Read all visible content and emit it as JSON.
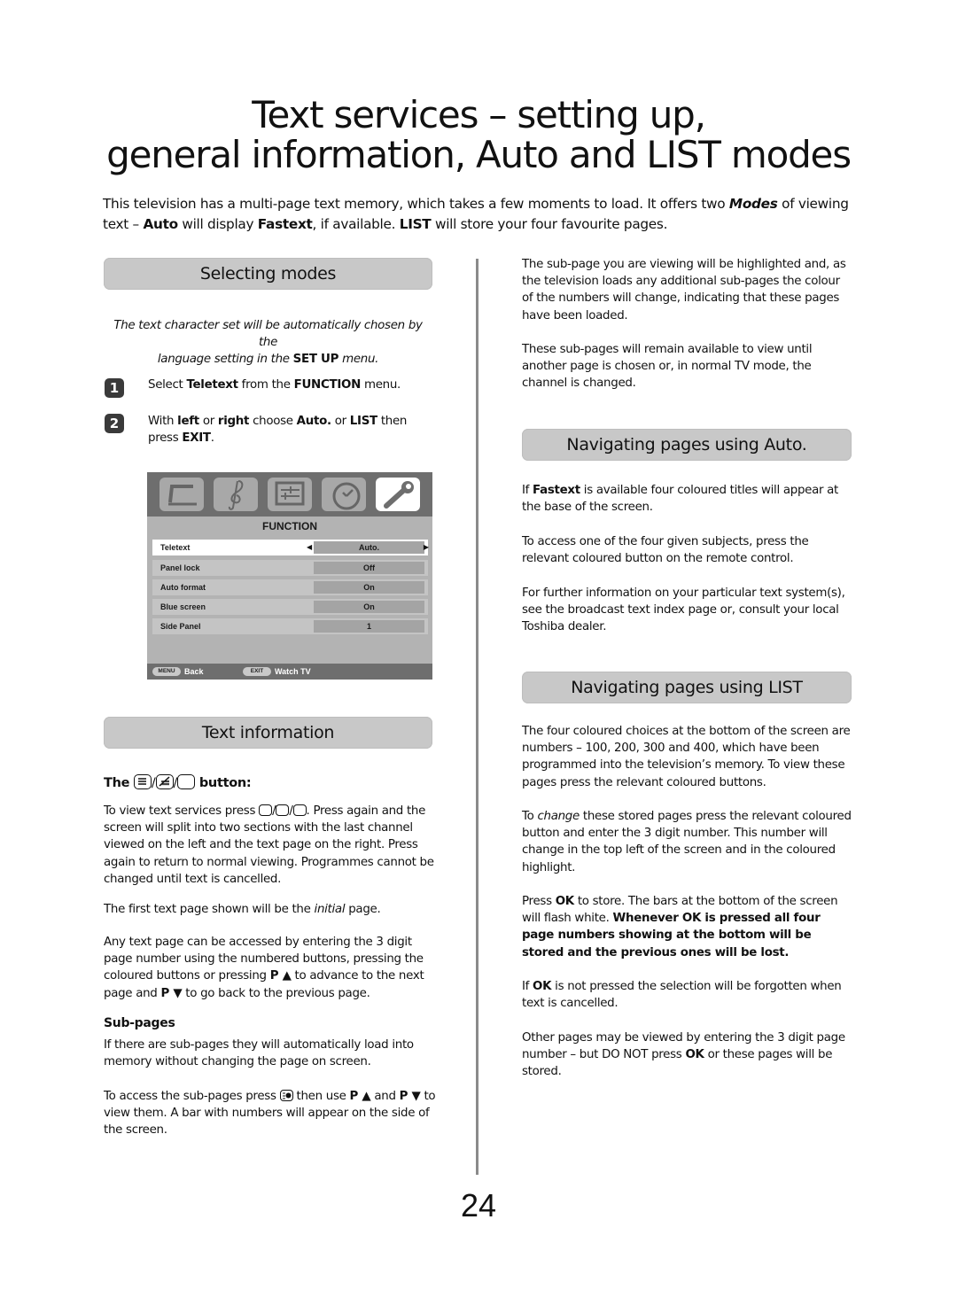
{
  "page": {
    "title_line1": "Text services – setting up,",
    "title_line2": "general information, Auto and LIST modes",
    "intro": {
      "t1": "This television has a multi-page text memory, which takes a few moments to load. It offers two ",
      "b1": "Modes",
      "t2": " of viewing text – ",
      "b2": "Auto",
      "t3": " will display ",
      "b3": "Fastext",
      "t4": ", if available. ",
      "b4": "LIST",
      "t5": " will store your four favourite pages."
    },
    "page_number": "24"
  },
  "selecting_modes": {
    "heading": "Selecting modes",
    "note_a": "The text character set will be automatically chosen by the",
    "note_b": "language setting in the ",
    "note_bold": "SET UP",
    "note_c": " menu.",
    "steps": [
      {
        "num": "1",
        "t1": "Select ",
        "b1": "Teletext",
        "t2": " from the ",
        "b2": "FUNCTION",
        "t3": " menu."
      },
      {
        "num": "2",
        "t1": "With ",
        "b1": "left",
        "t2": " or ",
        "b2": "right",
        "t3": " choose ",
        "b3": "Auto.",
        "t4": " or ",
        "b4": "LIST",
        "t5": " then press ",
        "b5": "EXIT",
        "t6": "."
      }
    ]
  },
  "tv_menu": {
    "icons": [
      "tv-picture-icon",
      "music-sound-icon",
      "settings-sliders-icon",
      "clock-timer-icon",
      "wrench-function-icon"
    ],
    "active_icon": "wrench-function-icon",
    "title": "FUNCTION",
    "rows": [
      {
        "label": "Teletext",
        "value": "Auto.",
        "selected": true
      },
      {
        "label": "Panel lock",
        "value": "Off"
      },
      {
        "label": "Auto format",
        "value": "On"
      },
      {
        "label": "Blue screen",
        "value": "On"
      },
      {
        "label": "Side Panel",
        "value": "1"
      }
    ],
    "footer": {
      "menu_key": "MENU",
      "menu_label": "Back",
      "exit_key": "EXIT",
      "exit_label": "Watch TV"
    }
  },
  "text_information": {
    "heading": "Text information",
    "button_heading_pre": "The ",
    "button_heading_post": " button:",
    "p1_pre": "To view text services press ",
    "p1_post": ". Press again and the screen will split into two sections with the last channel viewed on the left and the text page on the right. Press again to return to normal viewing. Programmes cannot be changed until text is cancelled.",
    "p2_pre": "The first text page shown will be the ",
    "p2_italic": "initial",
    "p2_post": " page.",
    "p3_a": "Any text page can be accessed by entering the 3 digit page number using the numbered buttons, pressing the coloured buttons or pressing ",
    "p3_b1": "P ▲",
    "p3_b": " to advance to the next page and ",
    "p3_b2": "P ▼",
    "p3_c": " to go back to the previous page.",
    "subpages_heading": "Sub-pages",
    "p4": "If there are sub-pages they will automatically load into memory without changing the page on screen.",
    "p5_a": "To access the sub-pages press ",
    "p5_b": " then use ",
    "p5_b1": "P ▲",
    "p5_c": " and  ",
    "p5_b2": "P ▼",
    "p5_d": " to view them. A bar with numbers will appear on the side of the screen."
  },
  "right_column": {
    "p1": "The sub-page you are viewing will be highlighted and, as the television loads any additional sub-pages the colour of the numbers will change, indicating that these pages have been loaded.",
    "p2": "These sub-pages will remain available to view until another page is chosen or, in normal TV mode, the channel is changed.",
    "auto_heading": "Navigating pages using Auto.",
    "auto_p1_a": "If ",
    "auto_p1_b": "Fastext",
    "auto_p1_c": " is available four coloured titles will appear at the base of the screen.",
    "auto_p2": "To access one of the four given subjects, press the relevant coloured button on the remote control.",
    "auto_p3": "For further information on your particular text system(s), see the broadcast text index page or, consult your local Toshiba dealer.",
    "list_heading": "Navigating pages using LIST",
    "list_p1": "The four coloured choices at the bottom of the screen are numbers – 100, 200, 300 and 400, which have been programmed into the television’s memory. To view these pages press the relevant coloured buttons.",
    "list_p2_a": "To ",
    "list_p2_i": "change",
    "list_p2_b": " these stored pages press the relevant coloured button and enter the 3 digit number. This number will change in the top left of the screen and in the coloured highlight.",
    "list_p3_a": "Press ",
    "list_p3_ok": "OK",
    "list_p3_b": " to store. The bars at the bottom of the screen will flash white. ",
    "list_p3_bold": "Whenever OK is pressed all four page numbers showing at the bottom will be stored and the previous ones will be lost.",
    "list_p4_a": "If ",
    "list_p4_ok": "OK",
    "list_p4_b": " is not pressed the selection will be forgotten when text is cancelled.",
    "list_p5_a": "Other pages may be viewed by entering the 3 digit page number – but DO NOT press ",
    "list_p5_ok": "OK",
    "list_p5_b": " or these pages will be stored."
  }
}
